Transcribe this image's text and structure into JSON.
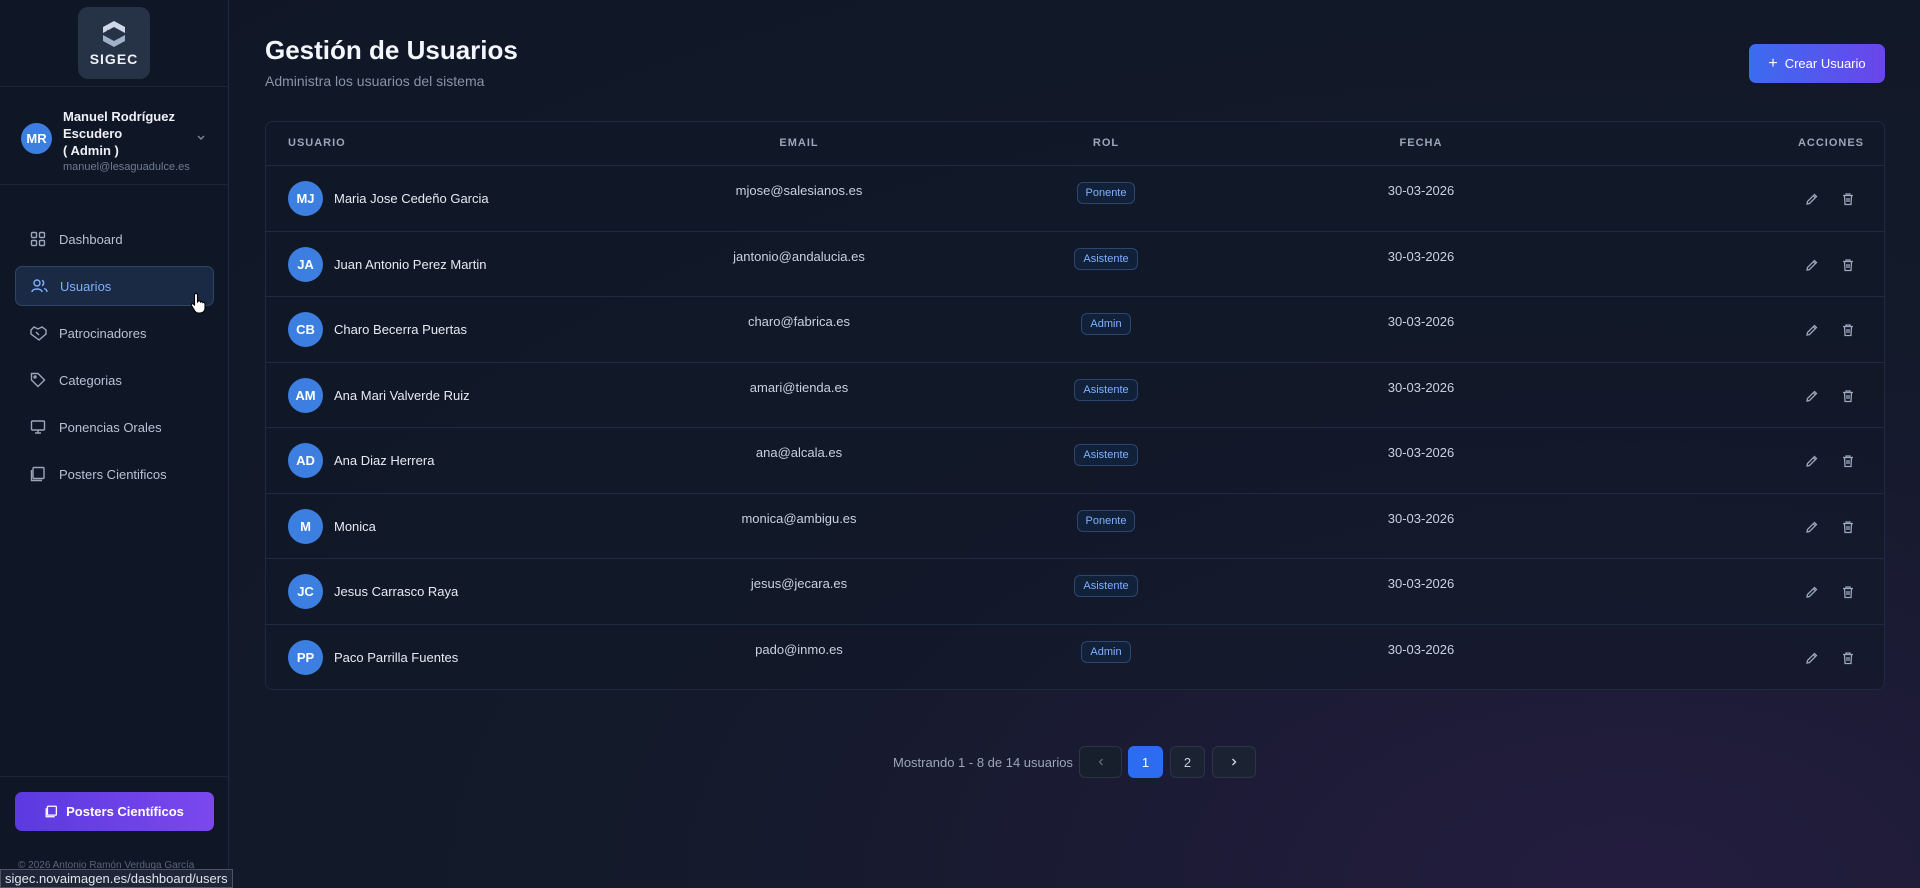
{
  "brand": {
    "logo_text": "SIGEC"
  },
  "user": {
    "initials": "MR",
    "name": "Manuel Rodríguez Escudero",
    "role": "( Admin )",
    "email": "manuel@lesaguadulce.es"
  },
  "nav": {
    "items": [
      {
        "label": "Dashboard",
        "icon": "dashboard-icon"
      },
      {
        "label": "Usuarios",
        "icon": "users-icon",
        "active": true
      },
      {
        "label": "Patrocinadores",
        "icon": "handshake-icon"
      },
      {
        "label": "Categorias",
        "icon": "tag-icon"
      },
      {
        "label": "Ponencias Orales",
        "icon": "monitor-icon"
      },
      {
        "label": "Posters Cientificos",
        "icon": "poster-icon"
      }
    ]
  },
  "sidebar_button": {
    "label": "Posters Científicos"
  },
  "footer": {
    "copyright": "© 2026 Antonio Ramón Verduga García"
  },
  "status_url": "sigec.novaimagen.es/dashboard/users",
  "page": {
    "title": "Gestión de Usuarios",
    "subtitle": "Administra los usuarios del sistema",
    "create_label": "Crear Usuario"
  },
  "table": {
    "headers": {
      "user": "USUARIO",
      "email": "EMAIL",
      "rol": "ROL",
      "fecha": "FECHA",
      "acciones": "ACCIONES"
    },
    "rows": [
      {
        "initials": "MJ",
        "name": "Maria Jose Cedeño Garcia",
        "email": "mjose@salesianos.es",
        "rol": "Ponente",
        "fecha": "30-03-2026"
      },
      {
        "initials": "JA",
        "name": "Juan Antonio Perez Martin",
        "email": "jantonio@andalucia.es",
        "rol": "Asistente",
        "fecha": "30-03-2026"
      },
      {
        "initials": "CB",
        "name": "Charo Becerra Puertas",
        "email": "charo@fabrica.es",
        "rol": "Admin",
        "fecha": "30-03-2026"
      },
      {
        "initials": "AM",
        "name": "Ana Mari Valverde Ruiz",
        "email": "amari@tienda.es",
        "rol": "Asistente",
        "fecha": "30-03-2026"
      },
      {
        "initials": "AD",
        "name": "Ana Diaz Herrera",
        "email": "ana@alcala.es",
        "rol": "Asistente",
        "fecha": "30-03-2026"
      },
      {
        "initials": "M",
        "name": "Monica",
        "email": "monica@ambigu.es",
        "rol": "Ponente",
        "fecha": "30-03-2026"
      },
      {
        "initials": "JC",
        "name": "Jesus Carrasco Raya",
        "email": "jesus@jecara.es",
        "rol": "Asistente",
        "fecha": "30-03-2026"
      },
      {
        "initials": "PP",
        "name": "Paco Parrilla Fuentes",
        "email": "pado@inmo.es",
        "rol": "Admin",
        "fecha": "30-03-2026"
      }
    ]
  },
  "pagination": {
    "info": "Mostrando 1 - 8 de 14 usuarios",
    "pages": [
      "1",
      "2"
    ],
    "current": "1"
  },
  "colors": {
    "accent": "#2b6cf0",
    "purple": "#6a45ea",
    "avatar": "#3d7fe0"
  }
}
